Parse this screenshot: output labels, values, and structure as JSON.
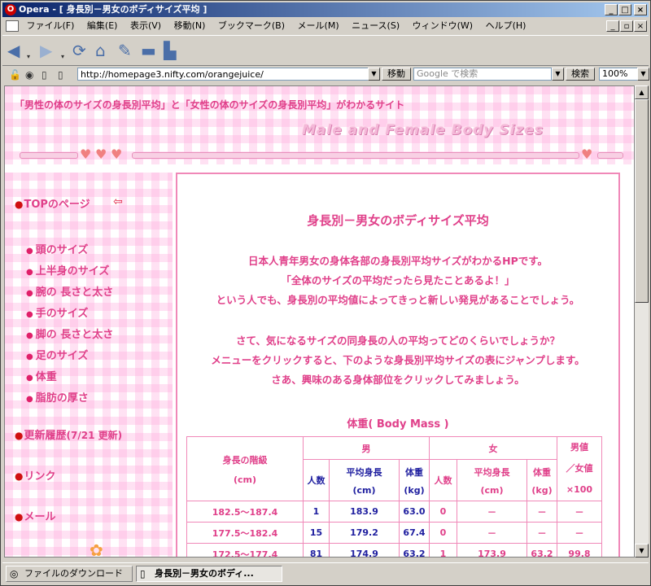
{
  "window": {
    "title": "Opera - [ 身長別－男女のボディサイズ平均 ]",
    "controls": [
      "_",
      "□",
      "×"
    ]
  },
  "menubar": {
    "items": [
      "ファイル(F)",
      "編集(E)",
      "表示(V)",
      "移動(N)",
      "ブックマーク(B)",
      "メール(M)",
      "ニュース(S)",
      "ウィンドウ(W)",
      "ヘルプ(H)"
    ]
  },
  "toolbar": {
    "icons": [
      "back-icon",
      "forward-icon",
      "reload-icon",
      "home-icon",
      "hotlist-icon",
      "print-icon",
      "save-icon"
    ]
  },
  "addressbar": {
    "url": "http://homepage3.nifty.com/orangejuice/",
    "go_label": "移動",
    "search_placeholder": "Google で検索",
    "search_label": "検索",
    "zoom": "100%"
  },
  "page": {
    "tagline": "「男性の体のサイズの身長別平均」と「女性の体のサイズの身長別平均」がわかるサイト",
    "logo_text": "Male and Female Body Sizes",
    "nav": {
      "top": "TOPのページ",
      "items": [
        "頭のサイズ",
        "上半身のサイズ",
        "腕の 長さと太さ",
        "手のサイズ",
        "脚の 長さと太さ",
        "足のサイズ",
        "体重",
        "脂肪の厚さ"
      ],
      "updates": "更新履歴",
      "updates_date": "(7/21 更新)",
      "links": "リンク",
      "mail": "メール"
    },
    "main_title": "身長別－男女のボディサイズ平均",
    "intro1": [
      "日本人青年男女の身体各部の身長別平均サイズがわかるHPです。",
      "「全体のサイズの平均だったら見たことあるよ！」",
      "という人でも、身長別の平均値によってきっと新しい発見があることでしょう。"
    ],
    "intro2": [
      "さて、気になるサイズの同身長の人の平均ってどのくらいでしょうか？",
      "メニューをクリックすると、下のような身長別平均サイズの表にジャンプします。",
      "さあ、興味のある身体部位をクリックしてみましょう。"
    ],
    "section_title": "体重( Body Mass )",
    "table": {
      "h_class": "身長の階級",
      "h_class_unit": "(cm)",
      "h_male": "男",
      "h_female": "女",
      "h_ratio1": "男値",
      "h_ratio2": "／女値",
      "h_ratio3": "×100",
      "h_count": "人数",
      "h_avg_height": "平均身長",
      "h_avg_height_unit": "(cm)",
      "h_weight": "体重",
      "h_weight_unit": "(kg)",
      "rows": [
        {
          "range": "182.5～187.4",
          "m_n": "1",
          "m_h": "183.9",
          "m_w": "63.0",
          "f_n": "0",
          "f_h": "－",
          "f_w": "－",
          "ratio": "－"
        },
        {
          "range": "177.5～182.4",
          "m_n": "15",
          "m_h": "179.2",
          "m_w": "67.4",
          "f_n": "0",
          "f_h": "－",
          "f_w": "－",
          "ratio": "－"
        },
        {
          "range": "172.5～177.4",
          "m_n": "81",
          "m_h": "174.9",
          "m_w": "63.2",
          "f_n": "1",
          "f_h": "173.9",
          "f_w": "63.2",
          "ratio": "99.8"
        }
      ]
    }
  },
  "taskbar": {
    "downloads": "ファイルのダウンロード",
    "active_tab": "身長別－男女のボディ..."
  },
  "colors": {
    "accent": "#e0408a",
    "border_pink": "#f088b8",
    "table_blue": "#2020a0"
  }
}
